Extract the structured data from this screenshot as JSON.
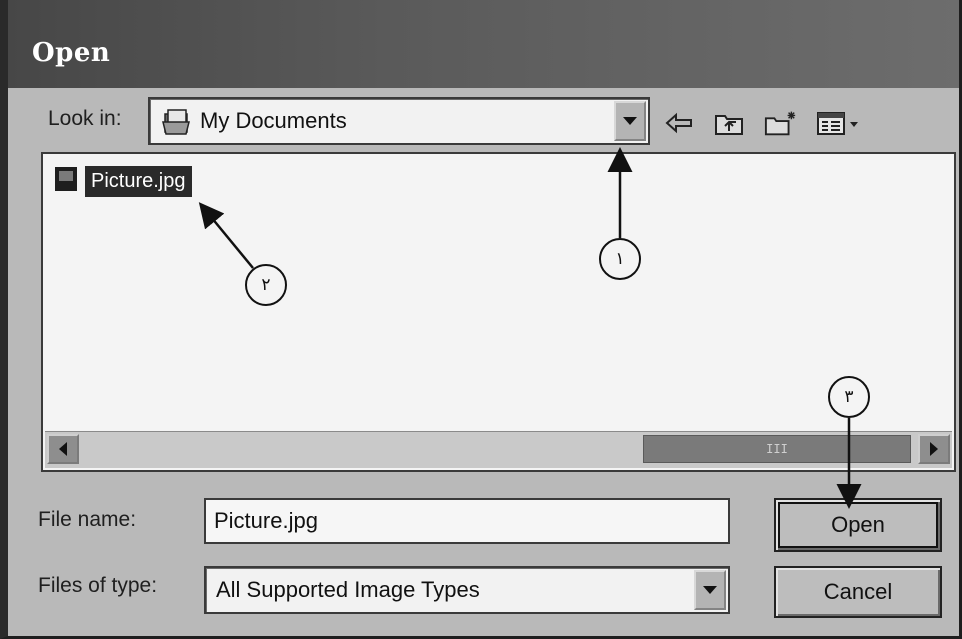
{
  "window": {
    "title": "Open"
  },
  "look_in": {
    "label": "Look in:",
    "value": "My Documents",
    "icon": "my-documents-icon"
  },
  "toolbar": {
    "icons": [
      "back-arrow-icon",
      "up-one-level-icon",
      "create-new-folder-icon",
      "view-menu-icon"
    ]
  },
  "files": [
    {
      "name": "Picture.jpg",
      "selected": true,
      "icon": "image-file-icon"
    }
  ],
  "scrollbar": {
    "thumb_label": "III"
  },
  "file_name": {
    "label": "File name:",
    "value": "Picture.jpg"
  },
  "files_of_type": {
    "label": "Files of type:",
    "value": "All Supported Image Types"
  },
  "buttons": {
    "open": "Open",
    "cancel": "Cancel"
  },
  "callouts": [
    "١",
    "٢",
    "٣"
  ],
  "colors": {
    "title_bar": "#4a4a4a",
    "dialog_bg": "#b9b9b9",
    "selection": "#2a2a2a"
  }
}
